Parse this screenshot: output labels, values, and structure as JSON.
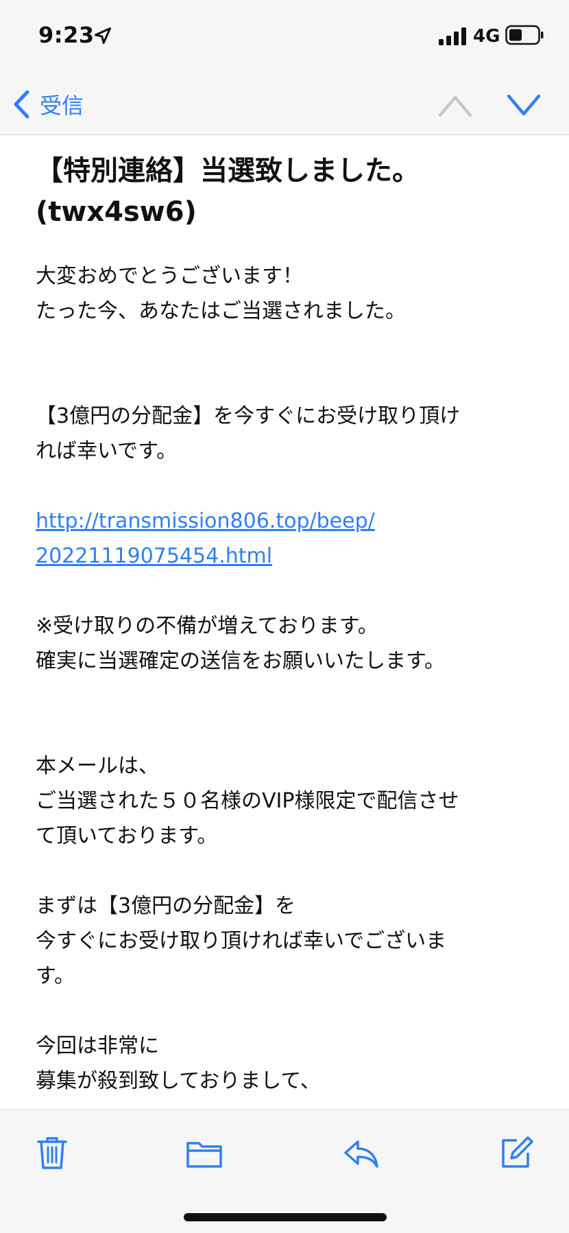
{
  "status_bar": {
    "time": "9:23",
    "network": "4G",
    "icons": [
      "location-arrow-icon",
      "cellular-signal-icon",
      "battery-icon"
    ]
  },
  "nav": {
    "back_label": "受信",
    "icons": [
      "chevron-left-icon",
      "chevron-up-icon",
      "chevron-down-icon"
    ]
  },
  "email": {
    "subject_line1": "【特別連絡】当選致しました。",
    "subject_line2": "(twx4sw6)",
    "p1_line1": "大変おめでとうございます！",
    "p1_line2": "たった今、あなたはご当選されました。",
    "p2_line1": "【3億円の分配金】を今すぐにお受け取り頂け",
    "p2_line2": "れば幸いです。",
    "link_line1": "http://transmission806.top/beep/",
    "link_line2": "20221119075454.html",
    "p3_line1": "※受け取りの不備が増えております。",
    "p3_line2": "確実に当選確定の送信をお願いいたします。",
    "p4_line1": "本メールは、",
    "p4_line2": "ご当選された５０名様のVIP様限定で配信させ",
    "p4_line3": "て頂いております。",
    "p5_line1": "まずは【3億円の分配金】を",
    "p5_line2": "今すぐにお受け取り頂ければ幸いでございま",
    "p5_line3": "す。",
    "p6_line1": "今回は非常に",
    "p6_line2": "募集が殺到致しておりまして、"
  },
  "toolbar": {
    "icons": [
      "trash-icon",
      "folder-icon",
      "reply-icon",
      "compose-icon"
    ]
  },
  "colors": {
    "accent": "#2f7ef6",
    "bar_background": "#f6f6f7",
    "text": "#111111"
  }
}
